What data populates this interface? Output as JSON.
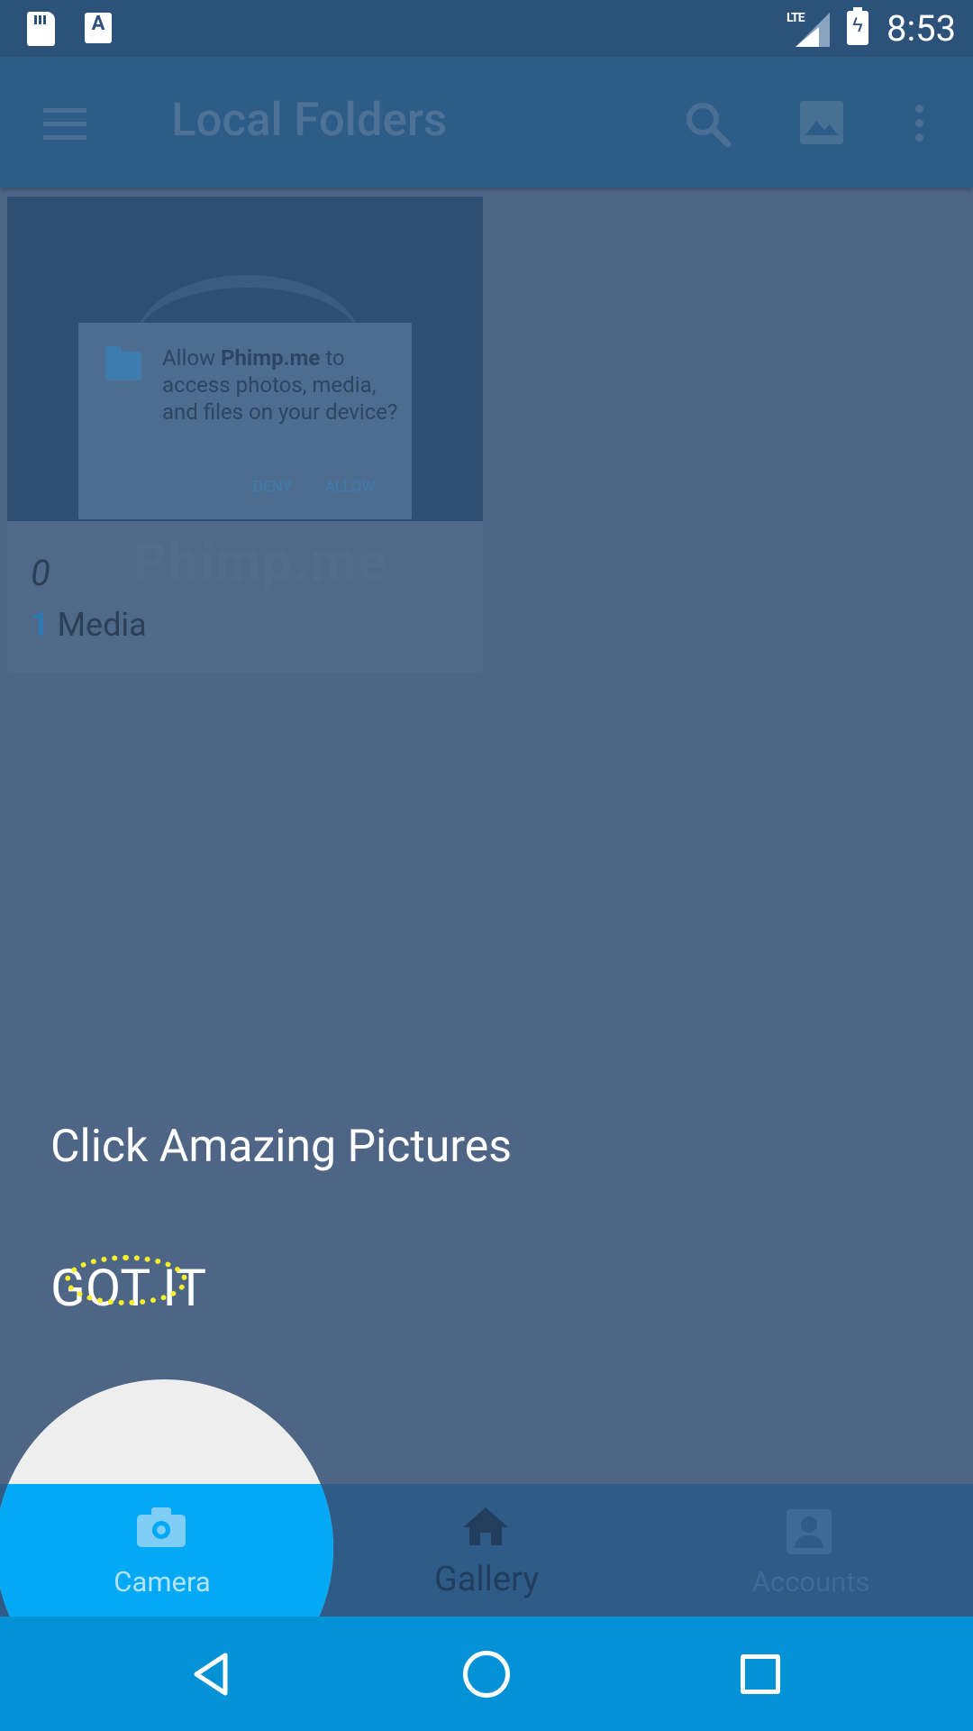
{
  "status_bar": {
    "time": "8:53",
    "network_label": "LTE",
    "icons": [
      "sd-card-icon",
      "a-notification-icon",
      "lte-signal-icon",
      "battery-charging-icon"
    ]
  },
  "app_bar": {
    "title": "Local Folders",
    "actions": [
      "search-icon",
      "image-icon",
      "more-vert-icon"
    ]
  },
  "album": {
    "name": "0",
    "media_count": "1",
    "media_label": "Media",
    "watermark_text": "Phimp.me"
  },
  "permission_dialog": {
    "prefix": "Allow ",
    "app_name": "Phimp.me",
    "suffix": " to access photos, media, and files on your device?",
    "deny_label": "DENY",
    "allow_label": "ALLOW"
  },
  "tutorial": {
    "title": "Click Amazing Pictures",
    "dismiss_label": "GOT IT"
  },
  "bottom_nav": {
    "items": [
      {
        "label": "Camera",
        "icon": "camera-icon",
        "active": true
      },
      {
        "label": "Gallery",
        "icon": "home-icon"
      },
      {
        "label": "Accounts",
        "icon": "account-icon"
      }
    ]
  },
  "system_nav": {
    "buttons": [
      "back",
      "home",
      "recents"
    ]
  },
  "colors": {
    "overlay": "#4e6585",
    "accent": "#03a9f4",
    "highlight_ring": "#f4f02a"
  }
}
